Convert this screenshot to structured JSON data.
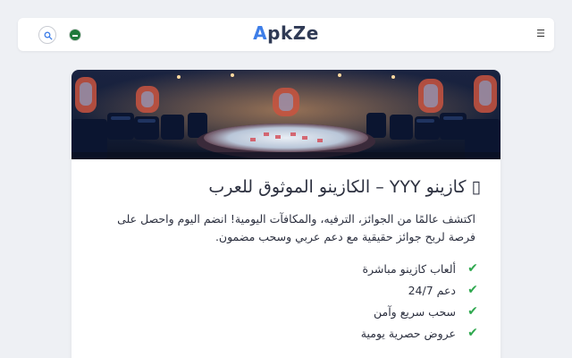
{
  "header": {
    "logo_first": "A",
    "logo_rest": "pkZe",
    "icons": {
      "search": "search-icon",
      "flag": "saudi-flag-icon",
      "menu": "hamburger-menu-icon"
    },
    "menu_glyph": "☰"
  },
  "main": {
    "hero_image": "casino-interior-image",
    "title": "▯ كازينو YYY – الكازينو الموثوق للعرب",
    "description": "اكتشف عالمًا من الجوائز، الترفيه، والمكافآت اليومية! انضم اليوم واحصل على فرصة لربح جوائز حقيقية مع دعم عربي وسحب مضمون.",
    "features": [
      "ألعاب كازينو مباشرة",
      "دعم 24/7",
      "سحب سريع وآمن",
      "عروض حصرية يومية"
    ],
    "check_glyph": "✔"
  },
  "colors": {
    "accent": "#3e7ee8",
    "logo_dark": "#2f3a55",
    "check": "#2fa84f",
    "background": "#eef0f4"
  }
}
